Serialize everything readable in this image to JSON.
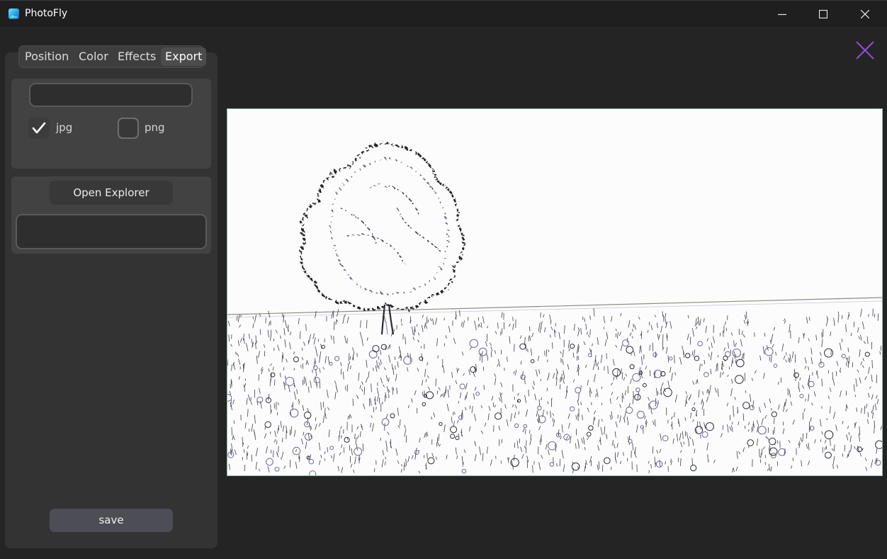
{
  "window": {
    "title": "PhotoFly",
    "app_icon": "photofly-app-icon",
    "controls": [
      "minimize-icon",
      "maximize-icon",
      "close-icon"
    ]
  },
  "tabs": [
    {
      "label": "Position",
      "active": false
    },
    {
      "label": "Color",
      "active": false
    },
    {
      "label": "Effects",
      "active": false
    },
    {
      "label": "Export",
      "active": true
    }
  ],
  "export": {
    "filename_value": "",
    "formats": [
      {
        "label": "jpg",
        "checked": true
      },
      {
        "label": "png",
        "checked": false
      }
    ],
    "open_explorer_label": "Open Explorer",
    "path_value": "",
    "save_label": "save"
  },
  "viewer": {
    "close_icon": "close-x-icon",
    "close_color": "#8a4fd8",
    "image_description": "sketch-filtered photo of a lone tree in a field"
  },
  "colors": {
    "background": "#242424",
    "panel": "#333334",
    "card": "#424243",
    "accent": "#8a4fd8"
  }
}
